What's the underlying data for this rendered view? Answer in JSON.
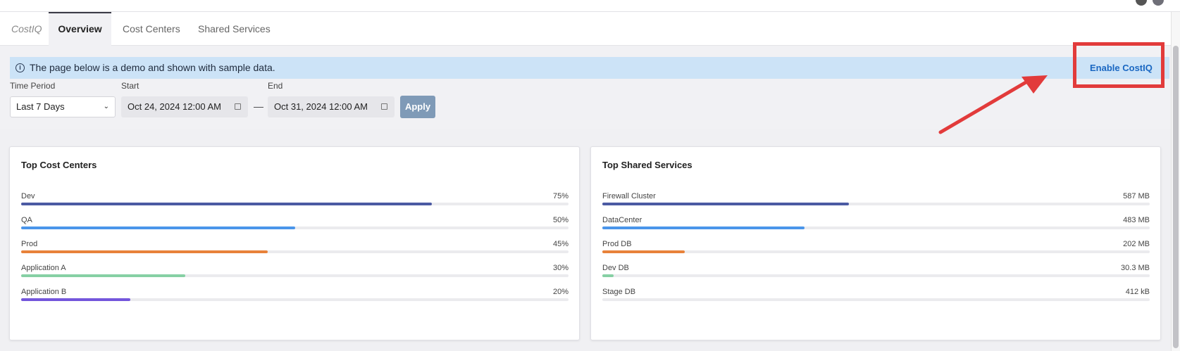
{
  "tabs": {
    "brand": "CostIQ",
    "items": [
      {
        "label": "Overview",
        "active": true
      },
      {
        "label": "Cost Centers",
        "active": false
      },
      {
        "label": "Shared Services",
        "active": false
      }
    ]
  },
  "banner": {
    "message": "The page below is a demo and shown with sample data.",
    "action": "Enable CostIQ"
  },
  "filters": {
    "time_period_label": "Time Period",
    "time_period_value": "Last 7 Days",
    "start_label": "Start",
    "start_value": "Oct 24, 2024 12:00 AM",
    "separator": "—",
    "end_label": "End",
    "end_value": "Oct 31, 2024 12:00 AM",
    "apply_label": "Apply"
  },
  "top_cost_centers": {
    "title": "Top Cost Centers",
    "items": [
      {
        "label": "Dev",
        "value": "75%",
        "fraction": 0.75,
        "color": "#4b5aa3"
      },
      {
        "label": "QA",
        "value": "50%",
        "fraction": 0.5,
        "color": "#4a95ea"
      },
      {
        "label": "Prod",
        "value": "45%",
        "fraction": 0.45,
        "color": "#e8823a"
      },
      {
        "label": "Application A",
        "value": "30%",
        "fraction": 0.3,
        "color": "#86d0a4"
      },
      {
        "label": "Application B",
        "value": "20%",
        "fraction": 0.2,
        "color": "#7456dc"
      }
    ]
  },
  "top_shared_services": {
    "title": "Top Shared Services",
    "items": [
      {
        "label": "Firewall Cluster",
        "value": "587 MB",
        "fraction": 0.45,
        "color": "#4b5aa3"
      },
      {
        "label": "DataCenter",
        "value": "483 MB",
        "fraction": 0.37,
        "color": "#4a95ea"
      },
      {
        "label": "Prod DB",
        "value": "202 MB",
        "fraction": 0.15,
        "color": "#e8823a"
      },
      {
        "label": "Dev DB",
        "value": "30.3 MB",
        "fraction": 0.02,
        "color": "#86d0a4"
      },
      {
        "label": "Stage DB",
        "value": "412 kB",
        "fraction": 0.0,
        "color": "#7456dc"
      }
    ]
  },
  "colors": {
    "accent": "#1a67c2",
    "banner_bg": "#cce3f7",
    "annotation": "#e23b3b"
  }
}
